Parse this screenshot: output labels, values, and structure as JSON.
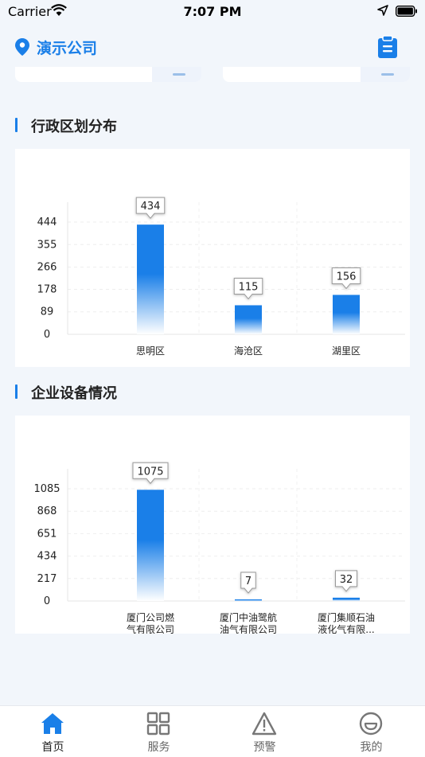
{
  "status_bar": {
    "carrier": "Carrier",
    "time": "7:07 PM"
  },
  "header": {
    "company": "演示公司"
  },
  "sections": {
    "district": {
      "title": "行政区划分布"
    },
    "equipment": {
      "title": "企业设备情况"
    }
  },
  "chart_data": [
    {
      "type": "bar",
      "categories": [
        "思明区",
        "海沧区",
        "湖里区"
      ],
      "values": [
        434,
        115,
        156
      ],
      "yticks": [
        0,
        89,
        178,
        266,
        355,
        444
      ],
      "ylim": [
        0,
        444
      ],
      "data_labels": [
        "434",
        "115",
        "156"
      ],
      "grid": true
    },
    {
      "type": "bar",
      "categories": [
        [
          "厦门公司燃",
          "气有限公司"
        ],
        [
          "厦门中油鹭航",
          "油气有限公司"
        ],
        [
          "厦门集顺石油",
          "液化气有限..."
        ]
      ],
      "values": [
        1075,
        7,
        32
      ],
      "yticks": [
        0,
        217,
        434,
        651,
        868,
        1085
      ],
      "ylim": [
        0,
        1085
      ],
      "data_labels": [
        "1075",
        "7",
        "32"
      ],
      "grid": true
    }
  ],
  "tabbar": {
    "items": [
      {
        "label": "首页",
        "icon": "home-icon",
        "active": true
      },
      {
        "label": "服务",
        "icon": "grid-icon",
        "active": false
      },
      {
        "label": "预警",
        "icon": "warning-icon",
        "active": false
      },
      {
        "label": "我的",
        "icon": "smile-icon",
        "active": false
      }
    ]
  },
  "colors": {
    "accent": "#1a7fe8",
    "bar_top": "#1a7fe8",
    "bar_bottom": "#ffffff"
  }
}
